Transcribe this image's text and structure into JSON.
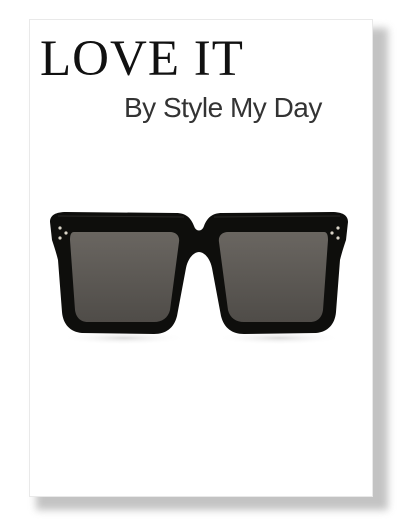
{
  "card": {
    "title": "LOVE IT",
    "subtitle": "By Style My Day"
  },
  "product": {
    "icon": "sunglasses-icon",
    "frame_color": "#0e0e0c",
    "lens_color": "#5a5753"
  }
}
